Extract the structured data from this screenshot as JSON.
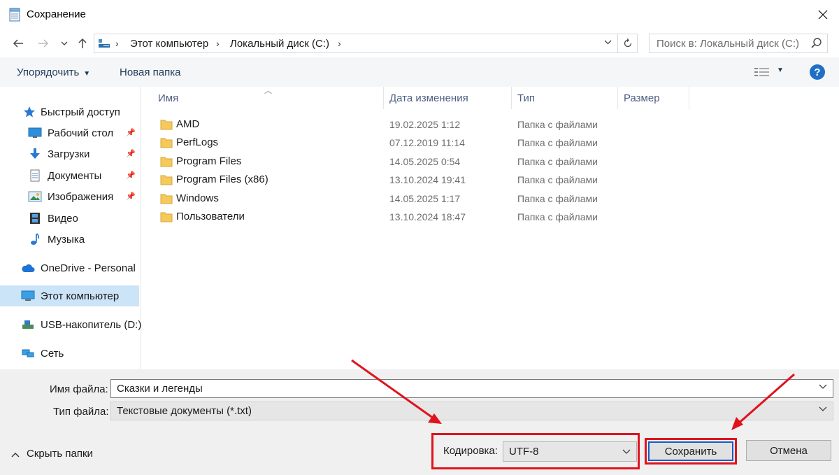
{
  "window": {
    "title": "Сохранение"
  },
  "address": {
    "crumbs": [
      "Этот компьютер",
      "Локальный диск (C:)"
    ],
    "search_placeholder": "Поиск в: Локальный диск (C:)"
  },
  "toolbar": {
    "organize": "Упорядочить",
    "new_folder": "Новая папка"
  },
  "sidebar": {
    "quick_access": "Быстрый доступ",
    "desktop": "Рабочий стол",
    "downloads": "Загрузки",
    "documents": "Документы",
    "pictures": "Изображения",
    "video": "Видео",
    "music": "Музыка",
    "onedrive": "OneDrive - Personal",
    "this_pc": "Этот компьютер",
    "usb": "USB-накопитель (D:)",
    "network": "Сеть"
  },
  "columns": {
    "name": "Имя",
    "date": "Дата изменения",
    "type": "Тип",
    "size": "Размер"
  },
  "files": [
    {
      "name": "AMD",
      "date": "19.02.2025 1:12",
      "type": "Папка с файлами"
    },
    {
      "name": "PerfLogs",
      "date": "07.12.2019 11:14",
      "type": "Папка с файлами"
    },
    {
      "name": "Program Files",
      "date": "14.05.2025 0:54",
      "type": "Папка с файлами"
    },
    {
      "name": "Program Files (x86)",
      "date": "13.10.2024 19:41",
      "type": "Папка с файлами"
    },
    {
      "name": "Windows",
      "date": "14.05.2025 1:17",
      "type": "Папка с файлами"
    },
    {
      "name": "Пользователи",
      "date": "13.10.2024 18:47",
      "type": "Папка с файлами"
    }
  ],
  "form": {
    "filename_label": "Имя файла:",
    "filename_value": "Сказки и легенды",
    "filetype_label": "Тип файла:",
    "filetype_value": "Текстовые документы (*.txt)",
    "encoding_label": "Кодировка:",
    "encoding_value": "UTF-8",
    "hide_folders": "Скрыть папки",
    "save": "Сохранить",
    "cancel": "Отмена"
  },
  "colors": {
    "annotation_red": "#e0131d",
    "focus_blue": "#0f5fc6",
    "selection": "#cce4f7"
  }
}
